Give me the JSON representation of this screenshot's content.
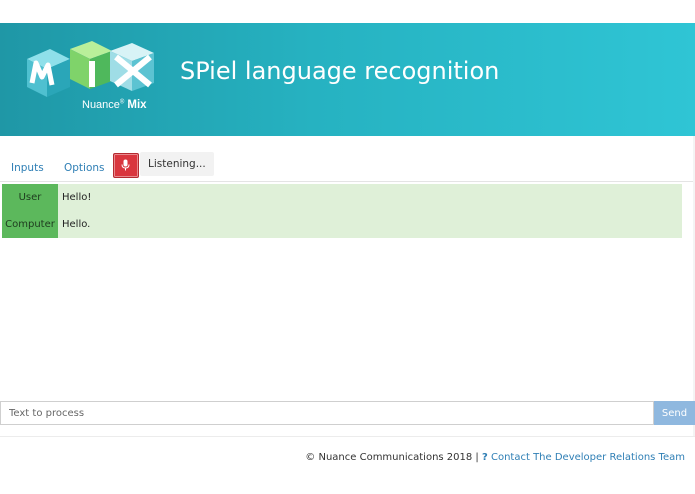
{
  "header": {
    "title": "SPiel language recognition",
    "brand_name": "Nuance",
    "brand_mark": "®",
    "brand_product": "Mix",
    "logo_text": "mix"
  },
  "tabs": [
    {
      "label": "Inputs"
    },
    {
      "label": "Options"
    }
  ],
  "mic": {
    "icon": "microphone-icon",
    "color": "#d9363e"
  },
  "status": {
    "text": "Listening..."
  },
  "conversation": [
    {
      "speaker": "User",
      "message": "Hello!"
    },
    {
      "speaker": "Computer",
      "message": "Hello."
    }
  ],
  "input": {
    "placeholder": "Text to process",
    "value": ""
  },
  "send": {
    "label": "Send"
  },
  "footer": {
    "copyright": "© Nuance Communications 2018 |",
    "help_mark": "?",
    "contact_link": "Contact The Developer Relations Team"
  },
  "colors": {
    "banner_start": "#1f97a6",
    "banner_end": "#2fc5d5",
    "speaker_bg": "#5cb85c",
    "row_bg": "#dff0d8",
    "link": "#2f7fb5",
    "send_bg": "#8fb8df"
  }
}
